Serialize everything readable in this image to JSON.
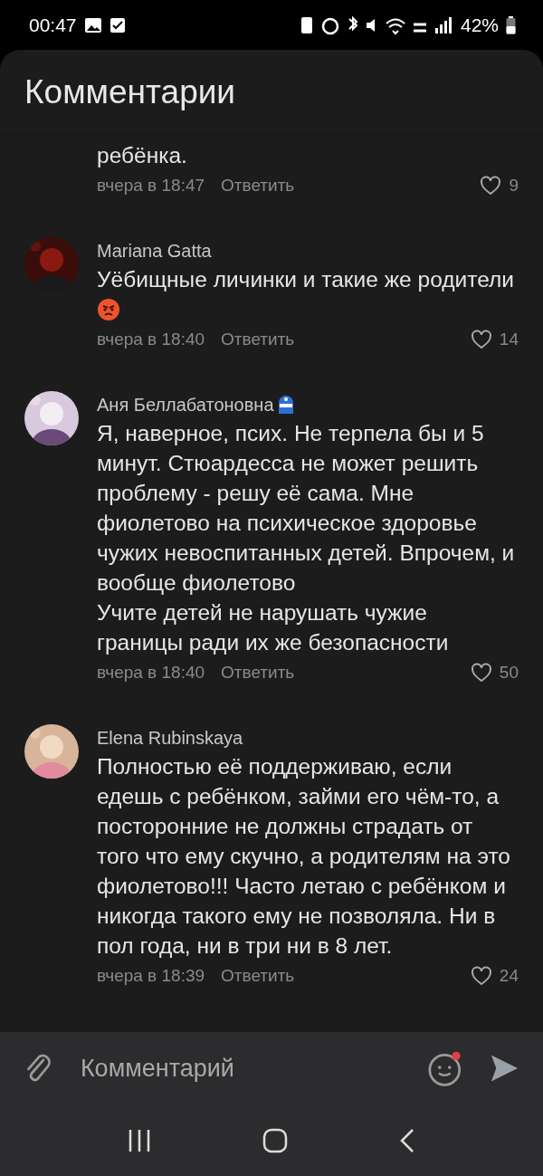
{
  "status_bar": {
    "time": "00:47",
    "battery": "42%"
  },
  "header": {
    "title": "Комментарии"
  },
  "comments": [
    {
      "kind": "continued",
      "text": "ребёнка.",
      "time": "вчера в 18:47",
      "reply": "Ответить",
      "likes": "9"
    },
    {
      "kind": "full",
      "author": "Mariana Gatta",
      "text": "Уёбищные личинки и такие же родители",
      "angry_emoji": true,
      "time": "вчера в 18:40",
      "reply": "Ответить",
      "likes": "14"
    },
    {
      "kind": "full",
      "author": "Аня Беллабатоновна",
      "mask_emoji": true,
      "text": "Я, наверное, псих.  Не терпела бы и 5 минут. Стюардесса не может решить проблему - решу её сама. Мне фиолетово на психическое здоровье чужих невоспитанных детей. Впрочем, и вообще фиолетово\nУчите детей не нарушать чужие границы ради их же безопасности",
      "time": "вчера в 18:40",
      "reply": "Ответить",
      "likes": "50"
    },
    {
      "kind": "full",
      "author": "Elena Rubinskaya",
      "text": "Полностью её поддерживаю, если едешь с ребёнком, займи его чём-то, а посторонние не должны страдать от того что ему скучно, а родителям на это фиолетово!!! Часто летаю с ребёнком и никогда такого ему не позволяла. Ни в пол года, ни в три ни в 8 лет.",
      "time": "вчера в 18:39",
      "reply": "Ответить",
      "likes": "24"
    }
  ],
  "composer": {
    "placeholder": "Комментарий",
    "emoji_badge": true
  }
}
